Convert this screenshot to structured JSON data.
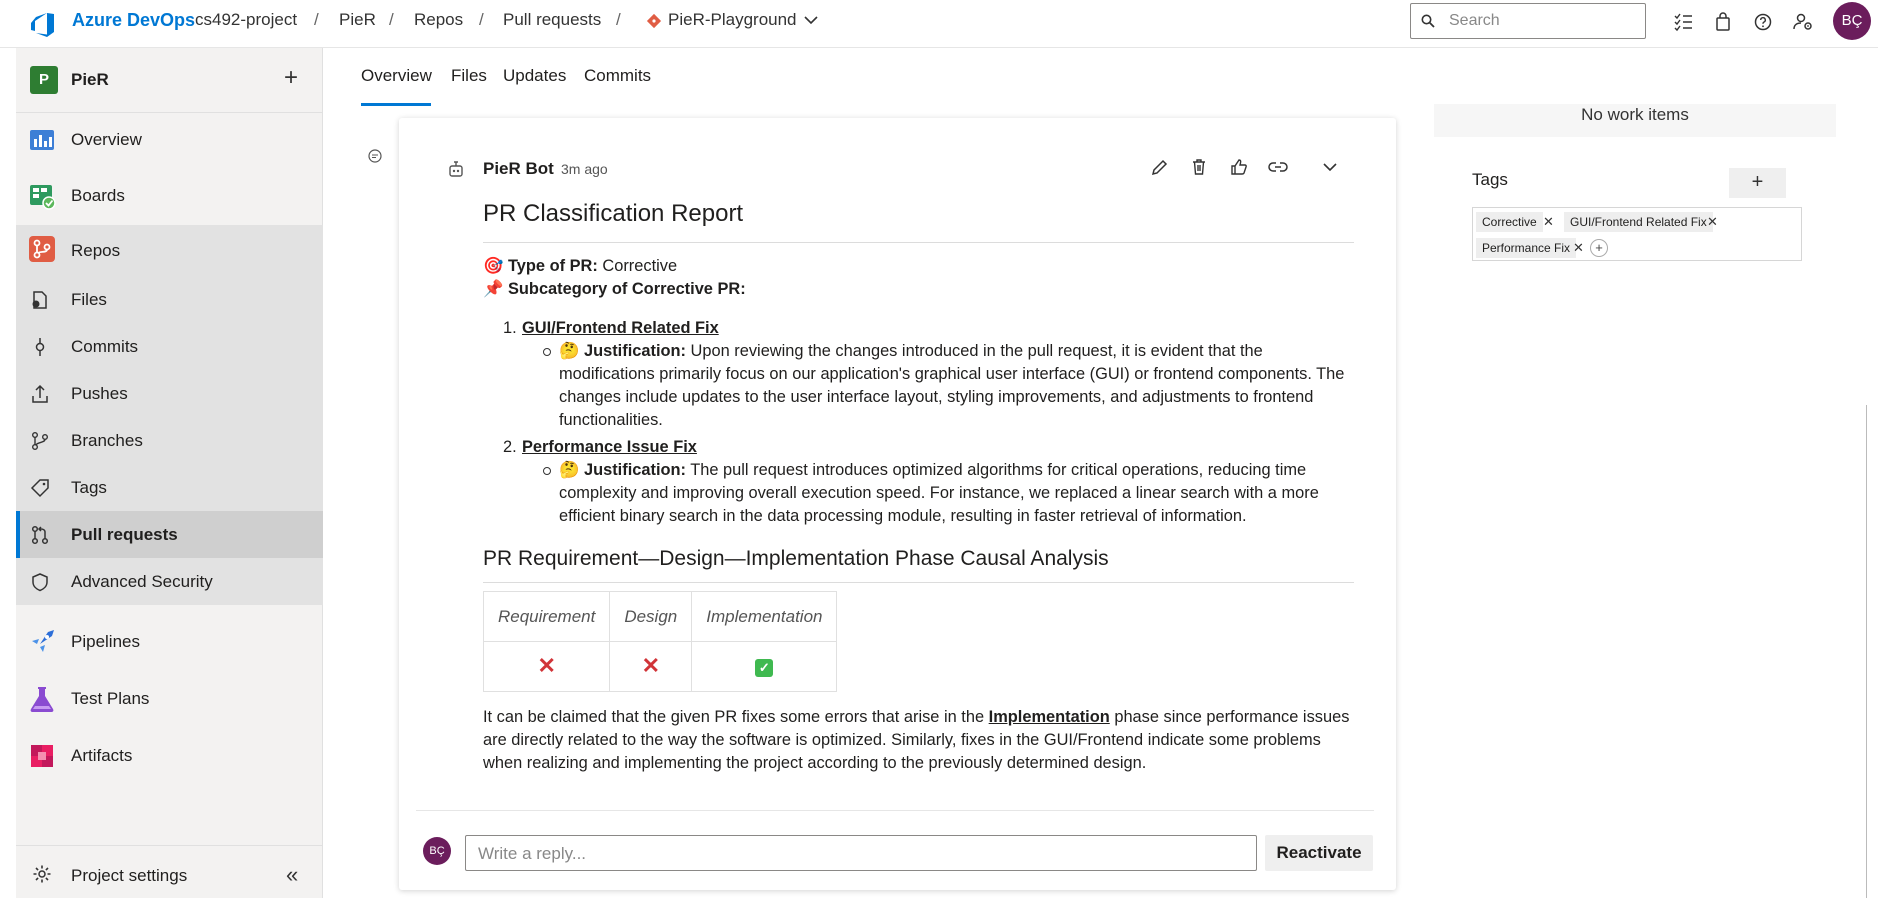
{
  "header": {
    "brand": "Azure DevOps",
    "org": "cs492-project",
    "sep": "/",
    "project": "PieR",
    "section": "Repos",
    "page": "Pull requests",
    "repo": "PieR-Playground",
    "search_placeholder": "Search",
    "user_initials": "BÇ"
  },
  "sidebar": {
    "project_initial": "P",
    "project_name": "PieR",
    "add": "+",
    "items": [
      {
        "label": "Overview"
      },
      {
        "label": "Boards"
      },
      {
        "label": "Repos"
      },
      {
        "label": "Files"
      },
      {
        "label": "Commits"
      },
      {
        "label": "Pushes"
      },
      {
        "label": "Branches"
      },
      {
        "label": "Tags"
      },
      {
        "label": "Pull requests"
      },
      {
        "label": "Advanced Security"
      },
      {
        "label": "Pipelines"
      },
      {
        "label": "Test Plans"
      },
      {
        "label": "Artifacts"
      }
    ],
    "settings": "Project settings",
    "collapse": "«"
  },
  "tabs": [
    "Overview",
    "Files",
    "Updates",
    "Commits"
  ],
  "comment": {
    "author": "PieR Bot",
    "time": "3m ago",
    "title": "PR Classification Report",
    "type_emoji": "🎯",
    "type_label": "Type of PR:",
    "type_value": "Corrective",
    "sub_emoji": "📌",
    "sub_label": "Subcategory of Corrective PR:",
    "items": [
      {
        "num": "1.",
        "name": "GUI/Frontend Related Fix",
        "emoji": "🤔",
        "just_label": "Justification:",
        "just_text": "Upon reviewing the changes introduced in the pull request, it is evident that the modifications primarily focus on our application's graphical user interface (GUI) or frontend components. The changes include updates to the user interface layout, styling improvements, and adjustments to frontend functionalities."
      },
      {
        "num": "2.",
        "name": "Performance Issue Fix",
        "emoji": "🤔",
        "just_label": "Justification:",
        "just_text": "The pull request introduces optimized algorithms for critical operations, reducing time complexity and improving overall execution speed. For instance, we replaced a linear search with a more efficient binary search in the data processing module, resulting in faster retrieval of information."
      }
    ],
    "analysis_title": "PR Requirement—Design—Implementation Phase Causal Analysis",
    "table_headers": [
      "Requirement",
      "Design",
      "Implementation"
    ],
    "table_marks": [
      "✕",
      "✕",
      "✓"
    ],
    "para_1": "It can be claimed that the given PR fixes some errors that arise in the",
    "para_bold": "Implementation",
    "para_2": "phase since performance issues are directly related to the way the software is optimized. Similarly, fixes in the GUI/Frontend indicate some problems when realizing and implementing the project according to the previously determined design.",
    "reply_initials": "BÇ",
    "reply_placeholder": "Write a reply...",
    "reactivate": "Reactivate"
  },
  "right_panel": {
    "no_work_items": "No work items",
    "tags_title": "Tags",
    "add": "+",
    "tags": [
      "Corrective",
      "GUI/Frontend Related Fix",
      "Performance Fix"
    ],
    "tag_remove": "✕"
  }
}
